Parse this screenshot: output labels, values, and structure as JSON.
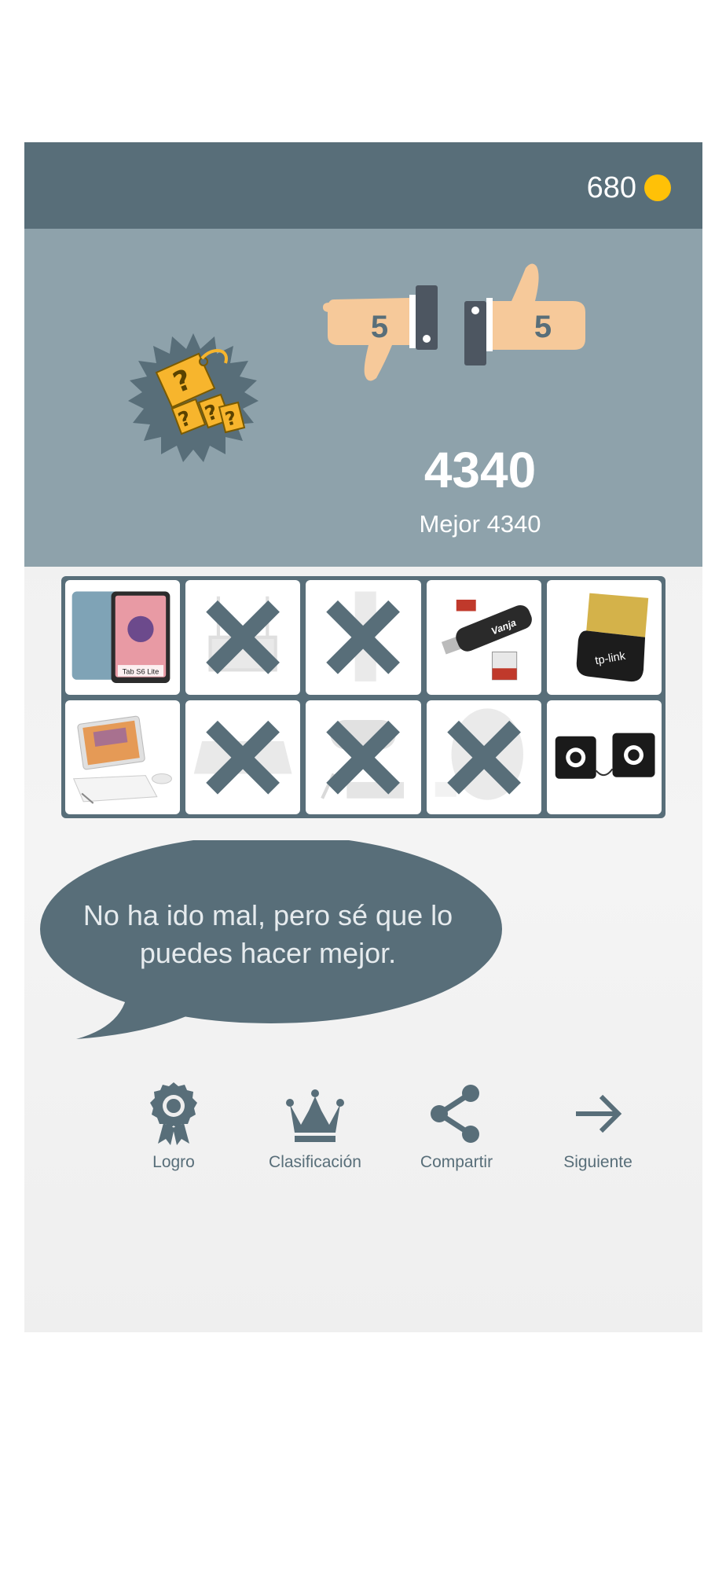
{
  "header": {
    "coins": "680",
    "coin_icon": "coin-icon",
    "accent": "#ffc107",
    "bar_color": "#586e79"
  },
  "result": {
    "badge_icon": "mystery-price-tag-icon",
    "dislikes": "5",
    "likes": "5",
    "score": "4340",
    "best": "Mejor 4340",
    "hero_color": "#8ea2ab"
  },
  "products": [
    {
      "name": "Samsung tablet",
      "label": "Tab S6 Lite",
      "crossed": false
    },
    {
      "name": "router antenna",
      "crossed": true
    },
    {
      "name": "wifi extender",
      "crossed": true
    },
    {
      "name": "card reader",
      "label": "Vanja",
      "crossed": false
    },
    {
      "name": "bluetooth adapter",
      "label": "tp-link",
      "crossed": false
    },
    {
      "name": "tablet with keyboard",
      "crossed": false
    },
    {
      "name": "projector",
      "crossed": true
    },
    {
      "name": "webcam",
      "crossed": true
    },
    {
      "name": "wireless mouse",
      "crossed": true
    },
    {
      "name": "mini speakers",
      "crossed": false
    }
  ],
  "message": "No ha ido mal, pero sé que lo puedes hacer mejor.",
  "actions": [
    {
      "label": "Logro",
      "icon": "award-icon"
    },
    {
      "label": "Clasificación",
      "icon": "crown-icon"
    },
    {
      "label": "Compartir",
      "icon": "share-icon"
    },
    {
      "label": "Siguiente",
      "icon": "arrow-right-icon"
    }
  ]
}
